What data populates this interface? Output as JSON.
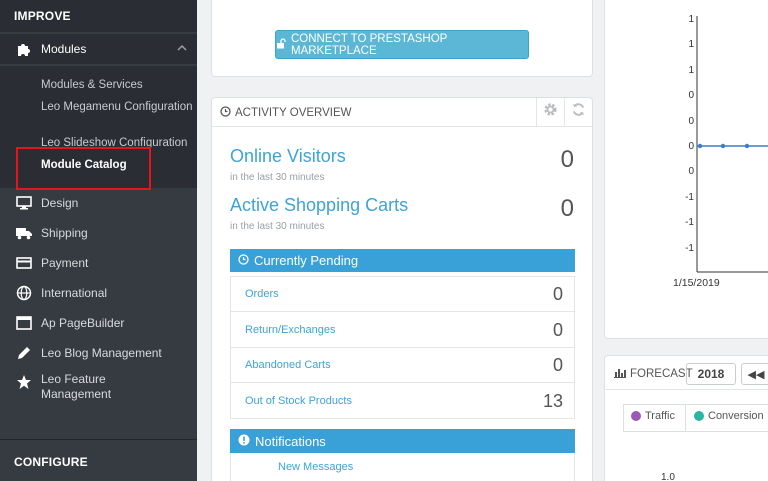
{
  "sidebar": {
    "improve_header": "IMPROVE",
    "configure_header": "CONFIGURE",
    "modules": {
      "label": "Modules",
      "icon": "puzzle-icon",
      "subitems": [
        {
          "label": "Modules & Services"
        },
        {
          "label": "Leo Megamenu Configuration"
        },
        {
          "label": "Leo Slideshow Configuration"
        },
        {
          "label": "Module Catalog"
        }
      ]
    },
    "items": [
      {
        "label": "Design",
        "icon": "monitor-icon"
      },
      {
        "label": "Shipping",
        "icon": "truck-icon"
      },
      {
        "label": "Payment",
        "icon": "credit-card-icon"
      },
      {
        "label": "International",
        "icon": "globe-icon"
      },
      {
        "label": "Ap PageBuilder",
        "icon": "window-icon"
      },
      {
        "label": "Leo Blog Management",
        "icon": "pencil-icon"
      },
      {
        "label": "Leo Feature Management",
        "icon": "star-icon"
      }
    ]
  },
  "main": {
    "connect_button": "CONNECT TO PRESTASHOP MARKETPLACE",
    "activity": {
      "title": "ACTIVITY OVERVIEW",
      "online_visitors": {
        "label": "Online Visitors",
        "sub": "in the last 30 minutes",
        "value": "0"
      },
      "active_carts": {
        "label": "Active Shopping Carts",
        "sub": "in the last 30 minutes",
        "value": "0"
      },
      "pending_header": "Currently Pending",
      "pending": [
        {
          "label": "Orders",
          "value": "0"
        },
        {
          "label": "Return/Exchanges",
          "value": "0"
        },
        {
          "label": "Abandoned Carts",
          "value": "0"
        },
        {
          "label": "Out of Stock Products",
          "value": "13"
        }
      ],
      "notifications_header": "Notifications",
      "new_messages": "New Messages"
    }
  },
  "chart": {
    "y_ticks": [
      "1",
      "1",
      "1",
      "0",
      "0",
      "0",
      "0",
      "-1",
      "-1",
      "-1"
    ],
    "x_label": "1/15/2019"
  },
  "forecast": {
    "title": "FORECAST",
    "year": "2018",
    "prev_symbol": "◀◀",
    "legend": [
      {
        "label": "Traffic",
        "color": "#9b59b6"
      },
      {
        "label": "Conversion",
        "color": "#2ab5a0"
      }
    ]
  },
  "colors": {
    "sidebar_bg": "#363a41",
    "accent_blue": "#3aa0d8",
    "link_blue": "#3ea3d6",
    "highlight_red": "#e3161c"
  }
}
